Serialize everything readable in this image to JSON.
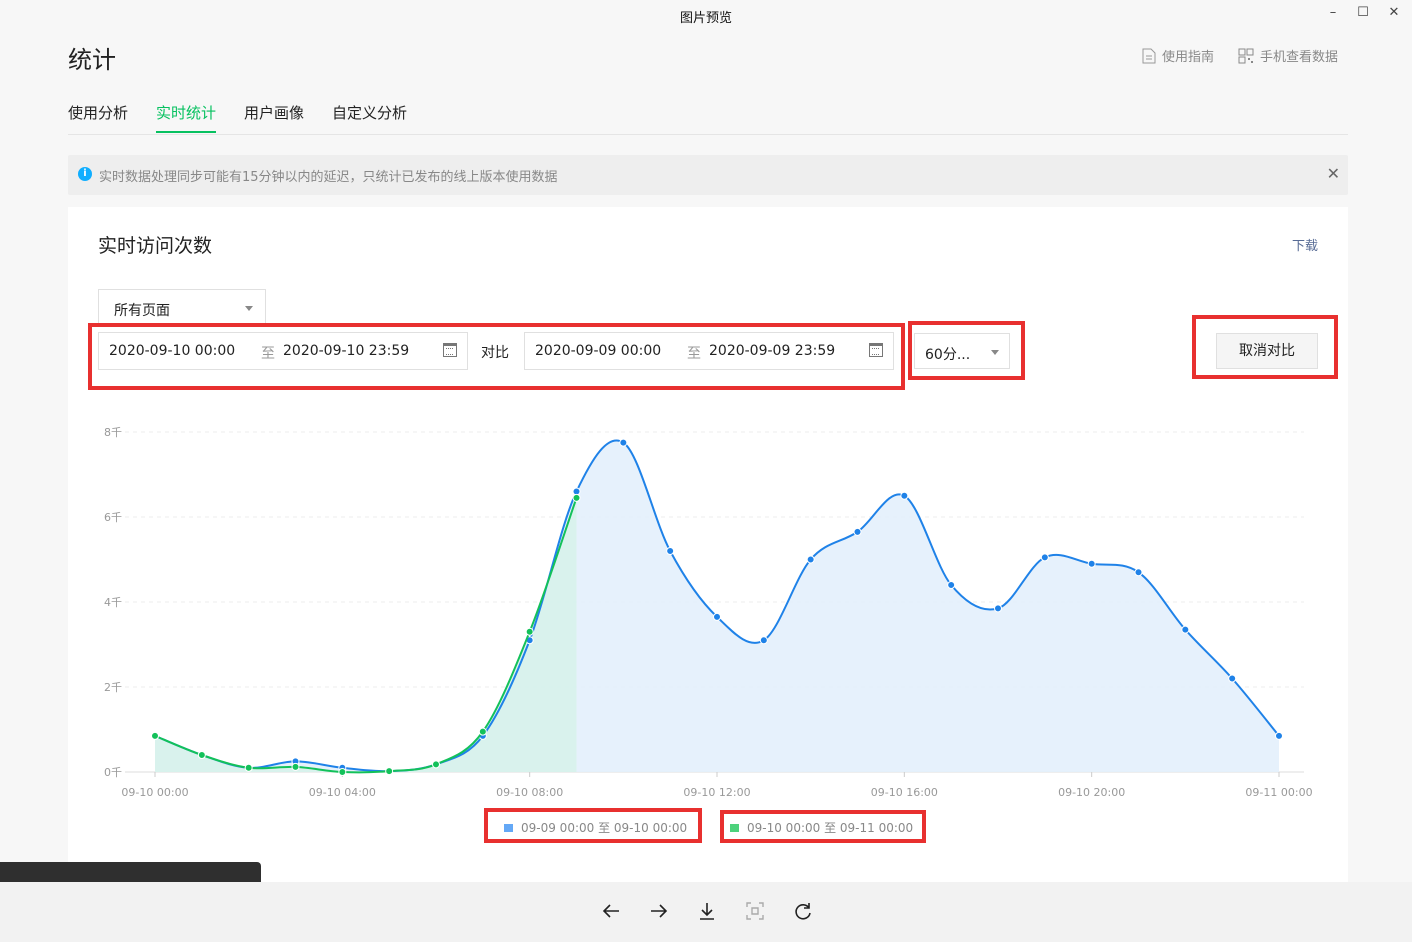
{
  "window": {
    "title": "图片预览",
    "controls": [
      "–",
      "☐",
      "✕"
    ]
  },
  "page": {
    "title": "统计"
  },
  "top_links": {
    "guide": "使用指南",
    "mobile": "手机查看数据"
  },
  "tabs": [
    {
      "label": "使用分析",
      "active": false
    },
    {
      "label": "实时统计",
      "active": true
    },
    {
      "label": "用户画像",
      "active": false
    },
    {
      "label": "自定义分析",
      "active": false
    }
  ],
  "notice": {
    "text": "实时数据处理同步可能有15分钟以内的延迟，只统计已发布的线上版本使用数据",
    "info_glyph": "i",
    "close_glyph": "✕"
  },
  "card": {
    "title": "实时访问次数",
    "download": "下载",
    "page_select": "所有页面",
    "range1": {
      "start": "2020-09-10 00:00",
      "sep": "至",
      "end": "2020-09-10 23:59"
    },
    "compare_label": "对比",
    "range2": {
      "start": "2020-09-09 00:00",
      "sep": "至",
      "end": "2020-09-09 23:59"
    },
    "interval_select": "60分...",
    "cancel_compare": "取消对比"
  },
  "colors": {
    "accent": "#07c160",
    "blue": "#1f82e8",
    "green": "#13c15a",
    "highlight": "#e8302f"
  },
  "chart_data": {
    "type": "area",
    "y_ticks": [
      "0千",
      "2千",
      "4千",
      "6千",
      "8千"
    ],
    "ylim": [
      0,
      8000
    ],
    "x_ticks": [
      "09-10 00:00",
      "09-10 04:00",
      "09-10 08:00",
      "09-10 12:00",
      "09-10 16:00",
      "09-10 20:00",
      "09-11 00:00"
    ],
    "x_hours": [
      0,
      1,
      2,
      3,
      4,
      5,
      6,
      7,
      8,
      9,
      10,
      11,
      12,
      13,
      14,
      15,
      16,
      17,
      18,
      19,
      20,
      21,
      22,
      23,
      24
    ],
    "series": [
      {
        "name": "09-09 00:00 至 09-10 00:00",
        "color": "#1f82e8",
        "values": [
          850,
          400,
          100,
          250,
          100,
          20,
          180,
          850,
          3100,
          6600,
          7750,
          5200,
          3650,
          3100,
          5000,
          5650,
          6500,
          4400,
          3850,
          5050,
          4900,
          4700,
          3350,
          2200,
          850
        ]
      },
      {
        "name": "09-10 00:00 至 09-11 00:00",
        "color": "#13c15a",
        "values": [
          850,
          400,
          100,
          120,
          0,
          20,
          180,
          950,
          3300,
          6450
        ]
      }
    ],
    "grid": true,
    "legend_position": "bottom"
  }
}
